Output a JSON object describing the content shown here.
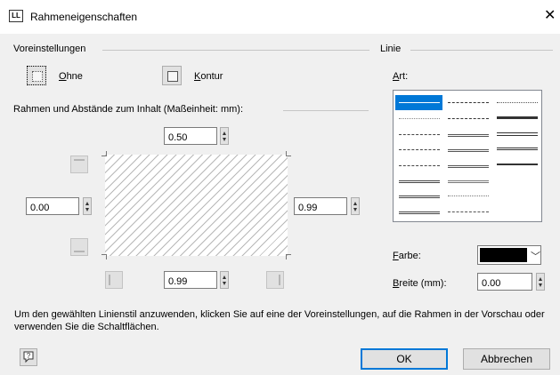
{
  "window": {
    "icon_text": "LL",
    "title": "Rahmeneigenschaften",
    "close_glyph": "✕"
  },
  "presets": {
    "group_label": "Voreinstellungen",
    "none_label": "Ohne",
    "none_mnemonic": "O",
    "none_rest": "hne",
    "outline_label": "Kontur",
    "outline_mnemonic": "K",
    "outline_rest": "ontur"
  },
  "frame": {
    "group_label": "Rahmen und Abstände zum Inhalt (Maßeinheit: mm):",
    "top_value": "0.50",
    "left_value": "0.00",
    "right_value": "0.99",
    "bottom_value": "0.99"
  },
  "line": {
    "group_label": "Linie",
    "style_label": "Art:",
    "style_mnemonic": "A",
    "style_rest": "rt:",
    "color_label": "Farbe:",
    "color_mnemonic": "F",
    "color_rest": "arbe:",
    "color_value": "#000000",
    "width_label": "Breite (mm):",
    "width_mnemonic": "B",
    "width_rest": "reite (mm):",
    "width_value": "0.00"
  },
  "hint_text": "Um den gewählten Linienstil anzuwenden, klicken Sie auf eine der Voreinstellungen, auf die Rahmen in der Vorschau oder verwenden Sie die Schaltflächen.",
  "buttons": {
    "ok_label": "OK",
    "cancel_label": "Abbrechen",
    "help_icon": "question-icon"
  },
  "colors": {
    "dialog_bg": "#f0f0f0",
    "accent": "#0078d7"
  }
}
